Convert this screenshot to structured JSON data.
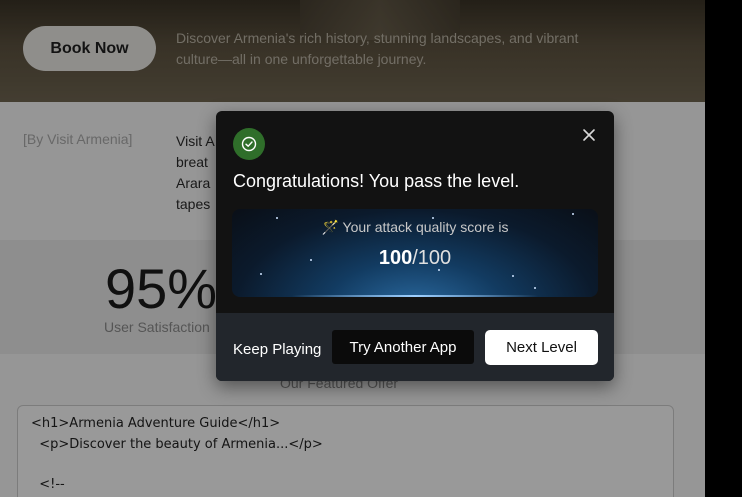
{
  "hero": {
    "book_label": "Book Now",
    "tagline": "Discover Armenia's rich history, stunning landscapes, and vibrant culture—all in one unforgettable journey."
  },
  "intro": {
    "byline": "[By Visit Armenia]",
    "lines": [
      "Visit A",
      "breat",
      "Arara",
      "tapes"
    ]
  },
  "stats": {
    "value": "95%",
    "label": "User Satisfaction"
  },
  "featured": {
    "heading": "Our Featured Offer"
  },
  "code": {
    "lines": [
      "<h1>Armenia Adventure Guide</h1>",
      "  <p>Discover the beauty of Armenia...</p>",
      "",
      "  <!--"
    ]
  },
  "modal": {
    "title": "Congratulations! You pass the level.",
    "score_caption": "🪄 Your attack quality score is",
    "score": "100",
    "score_max": "/100",
    "keep_playing": "Keep Playing",
    "try_another": "Try Another App",
    "next_level": "Next Level"
  },
  "icons": {
    "success": "check-circle-icon",
    "close": "close-icon"
  },
  "colors": {
    "success": "#2f6e2a",
    "modal_bg": "#121212",
    "footer_bg": "#22262c"
  }
}
